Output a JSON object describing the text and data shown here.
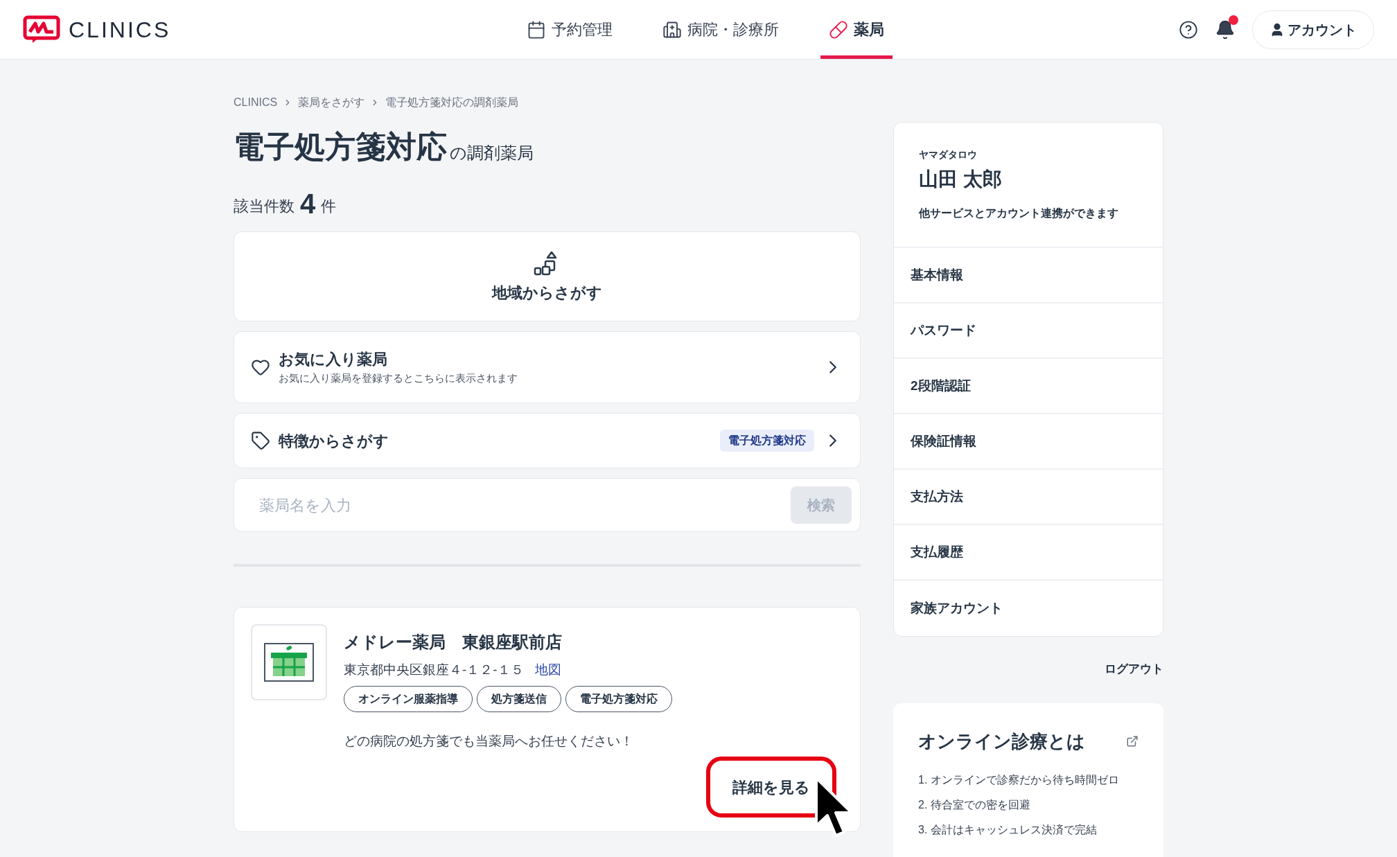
{
  "header": {
    "logo_text": "CLINICS",
    "nav": [
      {
        "label": "予約管理",
        "kind": "calendar",
        "selected": false
      },
      {
        "label": "病院・診療所",
        "kind": "hospital",
        "selected": false
      },
      {
        "label": "薬局",
        "kind": "pill",
        "selected": true
      }
    ],
    "notifications": {
      "unread": true
    },
    "account_button": "アカウント"
  },
  "breadcrumbs": [
    "CLINICS",
    "薬局をさがす",
    "電子処方箋対応の調剤薬局"
  ],
  "page_title": {
    "main": "電子処方箋対応",
    "suffix": "の調剤薬局"
  },
  "result_count": {
    "label": "該当件数",
    "number": "4",
    "unit": "件"
  },
  "search_options": [
    {
      "kind": "area",
      "title": "地域からさがす"
    },
    {
      "kind": "favorites",
      "title": "お気に入り薬局",
      "subtitle": "お気に入り薬局を登録するとこちらに表示されます"
    },
    {
      "kind": "features",
      "title": "特徴からさがす",
      "badge": "電子処方箋対応"
    }
  ],
  "search": {
    "placeholder": "薬局名を入力",
    "button": "検索",
    "disabled": true
  },
  "results": [
    {
      "name": "メドレー薬局　東銀座駅前店",
      "address": "東京都中央区銀座４-１２-１５",
      "map_link": "地図",
      "tags": [
        "オンライン服薬指導",
        "処方箋送信",
        "電子処方箋対応"
      ],
      "description": "どの病院の処方箋でも当薬局へお任せください！",
      "detail_button": "詳細を見る",
      "highlighted": true
    }
  ],
  "profile": {
    "kana": "ヤマダタロウ",
    "name": "山田 太郎",
    "note": "他サービスとアカウント連携ができます",
    "menu": [
      "基本情報",
      "パスワード",
      "2段階認証",
      "保険証情報",
      "支払方法",
      "支払履歴",
      "家族アカウント"
    ]
  },
  "logout": "ログアウト",
  "info_card": {
    "title": "オンライン診療とは",
    "items": [
      "1. オンラインで診察だから待ち時間ゼロ",
      "2. 待合室での密を回避",
      "3. 会計はキャッシュレス決済で完結"
    ]
  }
}
